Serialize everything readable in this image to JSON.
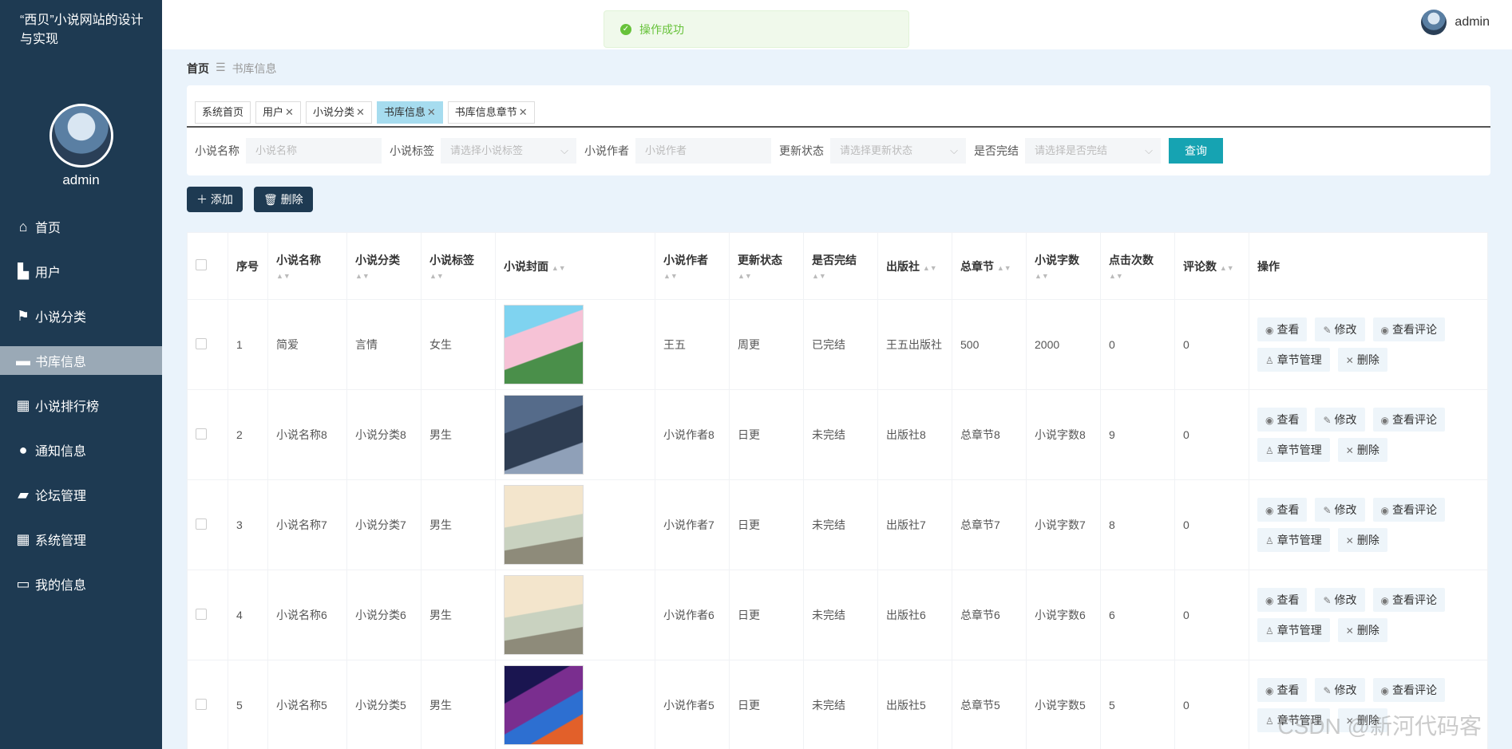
{
  "sidebar": {
    "site_title": "“西贝”小说网站的设计与实现",
    "admin_name": "admin",
    "items": [
      {
        "label": "首页",
        "icon": "home-icon"
      },
      {
        "label": "用户",
        "icon": "user-icon"
      },
      {
        "label": "小说分类",
        "icon": "flag-icon"
      },
      {
        "label": "书库信息",
        "icon": "chat-icon"
      },
      {
        "label": "小说排行榜",
        "icon": "grid-icon"
      },
      {
        "label": "通知信息",
        "icon": "bulb-icon"
      },
      {
        "label": "论坛管理",
        "icon": "wallet-icon"
      },
      {
        "label": "系统管理",
        "icon": "grid-icon"
      },
      {
        "label": "我的信息",
        "icon": "card-icon"
      }
    ]
  },
  "topbar": {
    "toast": "操作成功",
    "user": "admin"
  },
  "breadcrumb": {
    "home": "首页",
    "separator": "☰",
    "current": "书库信息"
  },
  "tabs": [
    {
      "label": "系统首页",
      "closable": false
    },
    {
      "label": "用户",
      "closable": true
    },
    {
      "label": "小说分类",
      "closable": true
    },
    {
      "label": "书库信息",
      "closable": true
    },
    {
      "label": "书库信息章节",
      "closable": true
    }
  ],
  "filters": {
    "name_label": "小说名称",
    "name_placeholder": "小说名称",
    "tag_label": "小说标签",
    "tag_placeholder": "请选择小说标签",
    "author_label": "小说作者",
    "author_placeholder": "小说作者",
    "status_label": "更新状态",
    "status_placeholder": "请选择更新状态",
    "finished_label": "是否完结",
    "finished_placeholder": "请选择是否完结",
    "query": "查询"
  },
  "actions": {
    "add": "添加",
    "delete": "删除"
  },
  "table": {
    "headers": [
      "序号",
      "小说名称",
      "小说分类",
      "小说标签",
      "小说封面",
      "小说作者",
      "更新状态",
      "是否完结",
      "出版社",
      "总章节",
      "小说字数",
      "点击次数",
      "评论数",
      "操作"
    ],
    "op_labels": {
      "view": "查看",
      "edit": "修改",
      "comments": "查看评论",
      "chapters": "章节管理",
      "delete": "删除"
    },
    "rows": [
      {
        "index": "1",
        "name": "简爱",
        "category": "言情",
        "tag": "女生",
        "author": "王五",
        "status": "周更",
        "finished": "已完结",
        "publisher": "王五出版社",
        "chapters": "500",
        "words": "2000",
        "clicks": "0",
        "comments": "0"
      },
      {
        "index": "2",
        "name": "小说名称8",
        "category": "小说分类8",
        "tag": "男生",
        "author": "小说作者8",
        "status": "日更",
        "finished": "未完结",
        "publisher": "出版社8",
        "chapters": "总章节8",
        "words": "小说字数8",
        "clicks": "9",
        "comments": "0"
      },
      {
        "index": "3",
        "name": "小说名称7",
        "category": "小说分类7",
        "tag": "男生",
        "author": "小说作者7",
        "status": "日更",
        "finished": "未完结",
        "publisher": "出版社7",
        "chapters": "总章节7",
        "words": "小说字数7",
        "clicks": "8",
        "comments": "0"
      },
      {
        "index": "4",
        "name": "小说名称6",
        "category": "小说分类6",
        "tag": "男生",
        "author": "小说作者6",
        "status": "日更",
        "finished": "未完结",
        "publisher": "出版社6",
        "chapters": "总章节6",
        "words": "小说字数6",
        "clicks": "6",
        "comments": "0"
      },
      {
        "index": "5",
        "name": "小说名称5",
        "category": "小说分类5",
        "tag": "男生",
        "author": "小说作者5",
        "status": "日更",
        "finished": "未完结",
        "publisher": "出版社5",
        "chapters": "总章节5",
        "words": "小说字数5",
        "clicks": "5",
        "comments": "0"
      }
    ]
  },
  "watermark": "CSDN @新河代码客"
}
